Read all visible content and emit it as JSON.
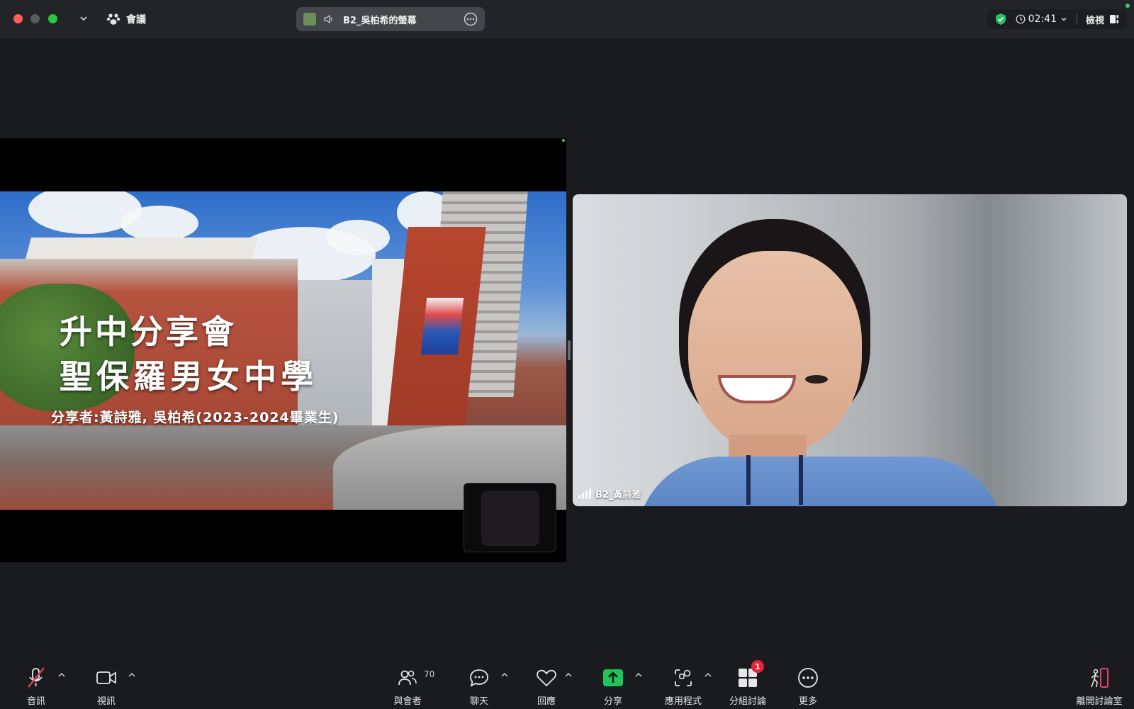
{
  "window": {
    "menu_label": "會議",
    "share_title": "B2_吳柏希的螢幕",
    "timer": "02:41",
    "view_label": "檢視"
  },
  "slide": {
    "line1": "升中分享會",
    "line2": "聖保羅男女中學",
    "line3": "分享者:黃詩雅, 吳柏希(2023-2024畢業生)"
  },
  "participant": {
    "name": "B2_黃詩雅"
  },
  "toolbar": {
    "audio_label": "音訊",
    "video_label": "視訊",
    "participants_label": "與會者",
    "participants_count": "70",
    "chat_label": "聊天",
    "reactions_label": "回應",
    "share_label": "分享",
    "apps_label": "應用程式",
    "breakout_label": "分組討論",
    "breakout_badge": "1",
    "more_label": "更多",
    "leave_label": "離開討論室"
  },
  "colors": {
    "accent_green": "#1fc55a",
    "badge_red": "#e8213a",
    "mute_red": "#e23b55",
    "leave_pink": "#e6406a"
  }
}
